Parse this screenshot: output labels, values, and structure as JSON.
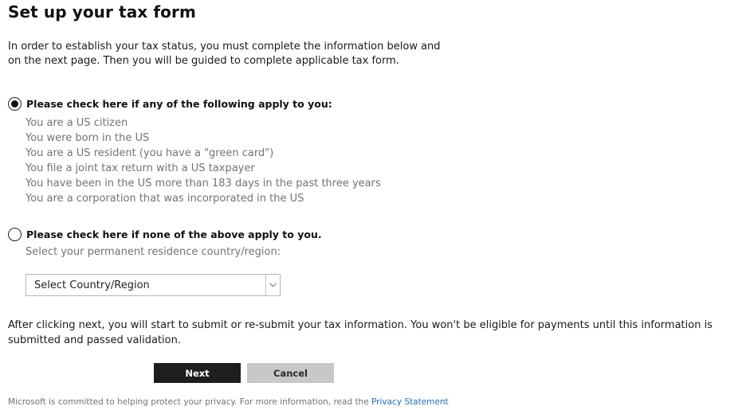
{
  "title": "Set up your tax form",
  "intro": "In order to establish your tax status, you must complete the information below and on the next page. Then you will be guided to complete applicable tax form.",
  "option_us": {
    "label": "Please check here if any of the following apply to you:",
    "checked": true,
    "criteria": [
      "You are a US citizen",
      "You were born in the US",
      "You are a US resident (you have a \"green card\")",
      "You file a joint tax return with a US taxpayer",
      "You have been in the US more than 183 days in the past three years",
      "You are a corporation that was incorporated in the US"
    ]
  },
  "option_non_us": {
    "label": "Please check here if none of the above apply to you.",
    "checked": false,
    "sub_label": "Select your permanent residence country/region:",
    "select_value": "Select Country/Region"
  },
  "notice": "After clicking next, you will start to submit or re-submit your tax information. You won't be eligible for payments until this information is submitted and passed validation.",
  "buttons": {
    "next": "Next",
    "cancel": "Cancel"
  },
  "footer": {
    "text": "Microsoft is committed to helping protect your privacy. For more information, read the",
    "link": "Privacy Statement"
  },
  "icons": {
    "dropdown": "chevron-down-icon"
  },
  "colors": {
    "primary_button": "#1e1e1e",
    "secondary_button": "#c8c8c8",
    "muted_text": "#737373",
    "link": "#1f6fc5"
  }
}
